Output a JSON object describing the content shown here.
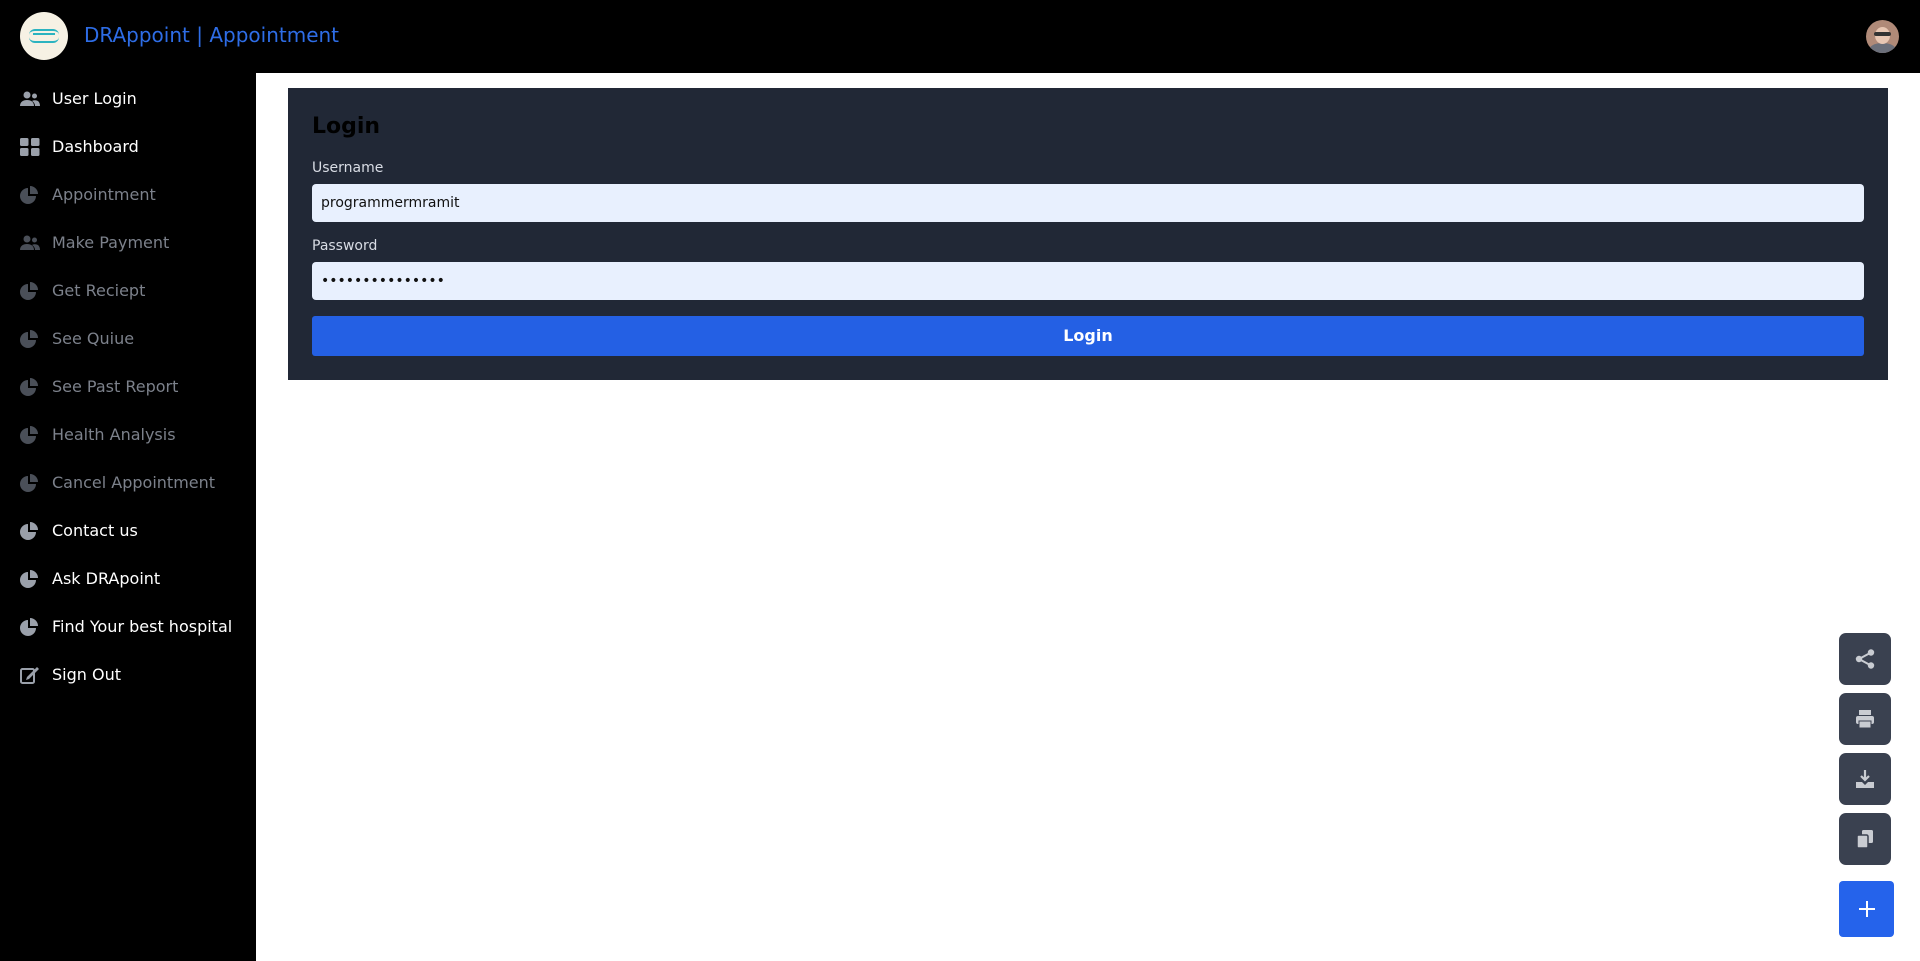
{
  "header": {
    "title": "DRAppoint | Appointment",
    "logo_icon": "drappoint-logo",
    "avatar_icon": "user-avatar",
    "accent_color": "#2e6de6"
  },
  "sidebar": {
    "items": [
      {
        "label": "User Login",
        "icon": "users-icon",
        "state": "active"
      },
      {
        "label": "Dashboard",
        "icon": "grid-icon",
        "state": "active"
      },
      {
        "label": "Appointment",
        "icon": "pie-chart-icon",
        "state": "dim"
      },
      {
        "label": "Make Payment",
        "icon": "users-icon",
        "state": "dim"
      },
      {
        "label": "Get Reciept",
        "icon": "pie-chart-icon",
        "state": "dim"
      },
      {
        "label": "See Quiue",
        "icon": "pie-chart-icon",
        "state": "dim"
      },
      {
        "label": "See Past Report",
        "icon": "pie-chart-icon",
        "state": "dim"
      },
      {
        "label": "Health Analysis",
        "icon": "pie-chart-icon",
        "state": "dim"
      },
      {
        "label": "Cancel Appointment",
        "icon": "pie-chart-icon",
        "state": "dim"
      },
      {
        "label": "Contact us",
        "icon": "pie-chart-icon",
        "state": "active"
      },
      {
        "label": "Ask DRApoint",
        "icon": "pie-chart-icon",
        "state": "active"
      },
      {
        "label": "Find Your best hospital",
        "icon": "pie-chart-icon",
        "state": "active"
      },
      {
        "label": "Sign Out",
        "icon": "sign-out-icon",
        "state": "active"
      }
    ]
  },
  "login": {
    "title": "Login",
    "username_label": "Username",
    "username_value": "programmermramit",
    "password_label": "Password",
    "password_value": "•••••••••••••••",
    "button_label": "Login",
    "button_color": "#2460e4",
    "card_color": "#212836"
  },
  "fabs": [
    {
      "icon": "share-icon"
    },
    {
      "icon": "print-icon"
    },
    {
      "icon": "download-icon"
    },
    {
      "icon": "copy-icon"
    },
    {
      "icon": "plus-icon"
    }
  ]
}
